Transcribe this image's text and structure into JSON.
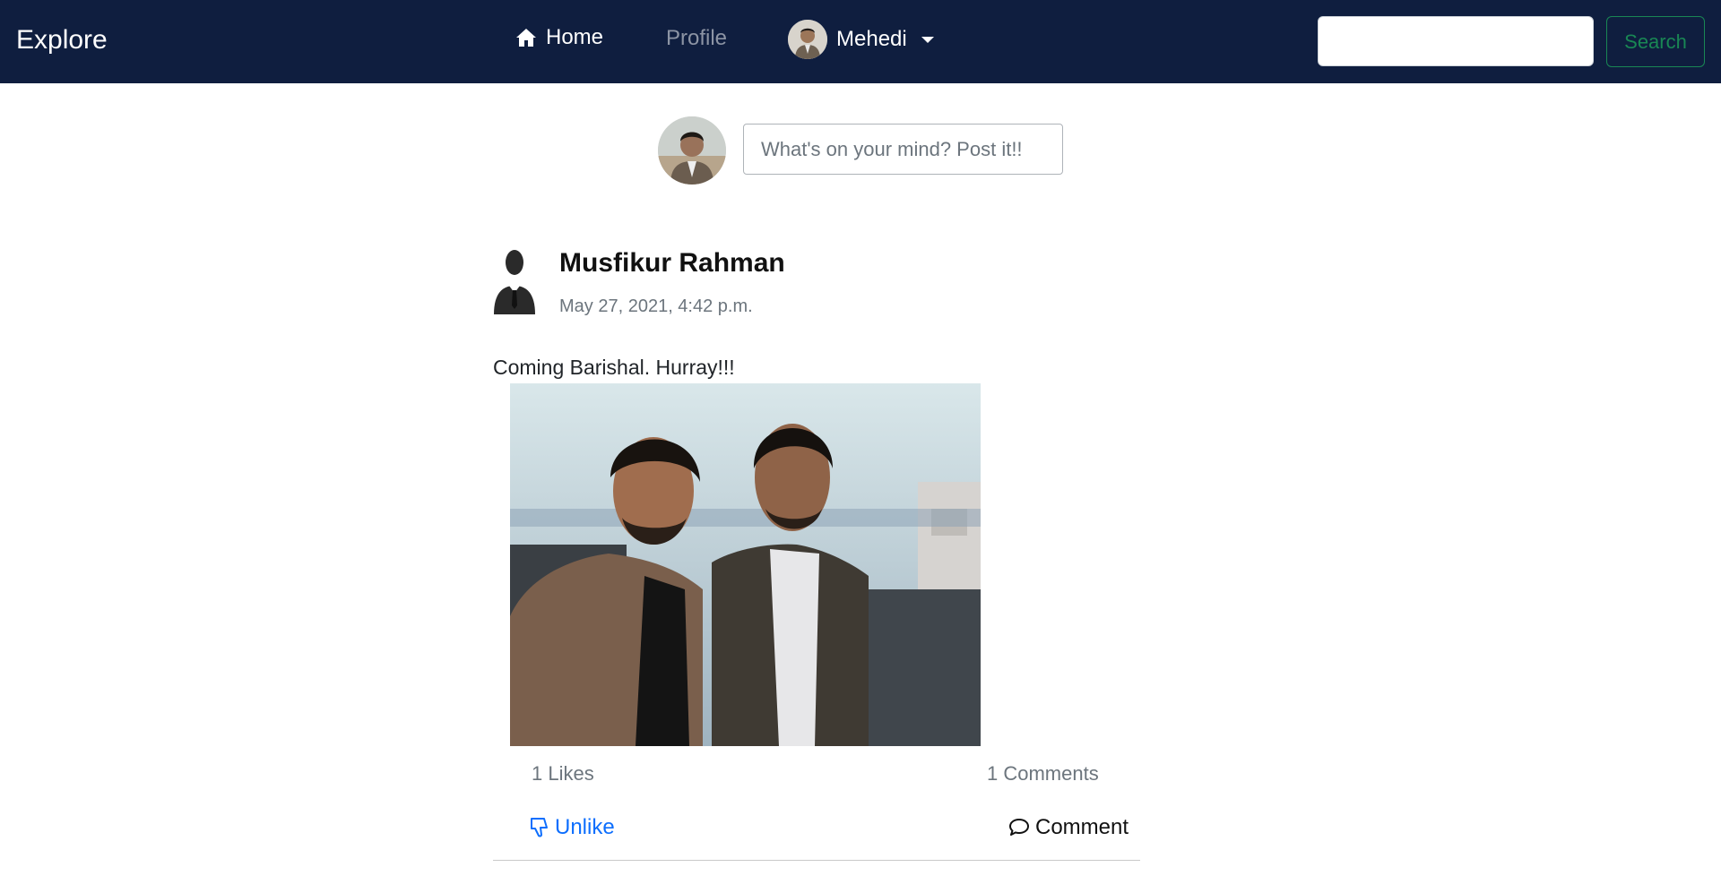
{
  "navbar": {
    "brand": "Explore",
    "home_label": "Home",
    "profile_label": "Profile",
    "user_name": "Mehedi",
    "search_placeholder": "",
    "search_button": "Search",
    "colors": {
      "background": "#0f1e3f",
      "search_accent": "#198754"
    }
  },
  "composer": {
    "placeholder": "What's on your mind? Post it!!"
  },
  "post": {
    "author": "Musfikur Rahman",
    "date": "May 27, 2021, 4:42 p.m.",
    "text": "Coming Barishal. Hurray!!!",
    "likes": "1 Likes",
    "comments": "1 Comments",
    "unlike_label": "Unlike",
    "comment_label": "Comment",
    "icons": [
      "home-icon",
      "thumbs-down-icon",
      "speech-bubble-icon",
      "caret-down-icon"
    ]
  }
}
